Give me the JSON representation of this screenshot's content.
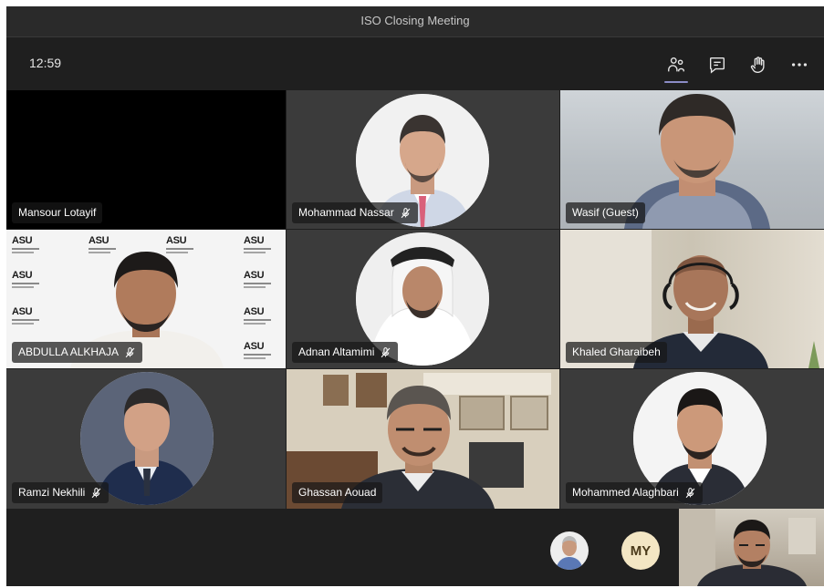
{
  "window": {
    "title": "ISO Closing Meeting"
  },
  "toolbar": {
    "time": "12:59",
    "icons": [
      "participants-icon",
      "chat-icon",
      "raise-hand-icon",
      "more-icon"
    ]
  },
  "participants": [
    {
      "name": "Mansour Lotayif",
      "muted": false
    },
    {
      "name": "Mohammad Nassar",
      "muted": true
    },
    {
      "name": "Wasif (Guest)",
      "muted": false
    },
    {
      "name": "ABDULLA ALKHAJA",
      "muted": true
    },
    {
      "name": "Adnan Altamimi",
      "muted": true
    },
    {
      "name": "Khaled Gharaibeh",
      "muted": false
    },
    {
      "name": "Ramzi Nekhili",
      "muted": true
    },
    {
      "name": "Ghassan Aouad",
      "muted": false
    },
    {
      "name": "Mohammed Alaghbari",
      "muted": true
    }
  ],
  "background_logo": "ASU",
  "overflow": {
    "initials": "MY"
  },
  "colors": {
    "accent": "#8b8cc7",
    "background": "#1f1f1f",
    "tile": "#3b3b3b"
  }
}
